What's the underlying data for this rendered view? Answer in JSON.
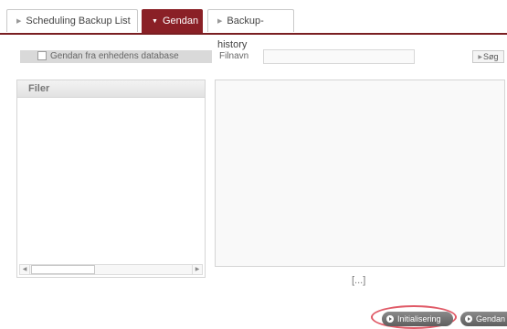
{
  "tabs": [
    {
      "label": "Scheduling Backup List",
      "active": false
    },
    {
      "label": "Gendan",
      "active": true
    },
    {
      "label": "Backup-history",
      "active": false
    }
  ],
  "options": {
    "restore_from_db_label": "Gendan fra enhedens database",
    "restore_from_db_checked": false
  },
  "filename": {
    "label": "Filnavn",
    "value": "",
    "placeholder": ""
  },
  "search_button_label": "Søg",
  "files_panel": {
    "header": "Filer"
  },
  "preview_footer": "[...]",
  "buttons": {
    "init_label": "Initialisering",
    "restore_label": "Gendan"
  },
  "colors": {
    "accent": "#8a2026",
    "highlight": "#e05a67",
    "button": "#6e6e6e"
  }
}
